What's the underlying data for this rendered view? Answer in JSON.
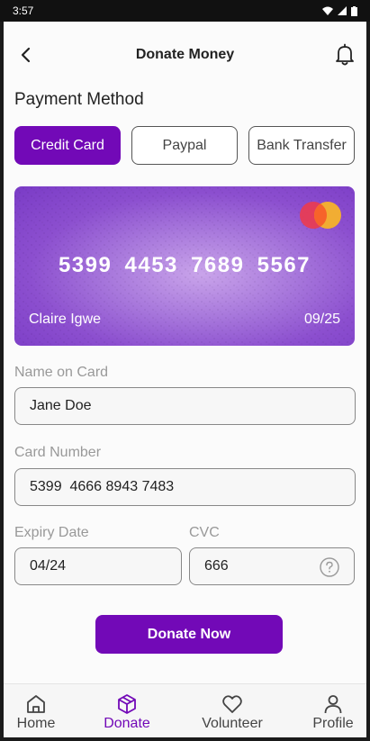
{
  "status_bar": {
    "time": "3:57"
  },
  "header": {
    "title": "Donate Money"
  },
  "payment": {
    "section_title": "Payment Method",
    "tabs": [
      {
        "label": "Credit Card",
        "active": true
      },
      {
        "label": "Paypal",
        "active": false
      },
      {
        "label": "Bank Transfer",
        "active": false
      }
    ]
  },
  "card": {
    "number": "5399 4453 7689 5567",
    "holder": "Claire Igwe",
    "expiry": "09/25",
    "brand_icon": "mastercard-icon"
  },
  "form": {
    "name_label": "Name on Card",
    "name_value": "Jane Doe",
    "number_label": "Card Number",
    "number_value": "5399  4666 8943 7483",
    "expiry_label": "Expiry Date",
    "expiry_value": "04/24",
    "cvc_label": "CVC",
    "cvc_value": "666"
  },
  "actions": {
    "donate_label": "Donate Now"
  },
  "nav": {
    "items": [
      {
        "label": "Home",
        "icon": "home-icon"
      },
      {
        "label": "Donate",
        "icon": "donate-box-icon",
        "active": true
      },
      {
        "label": "Volunteer",
        "icon": "heart-icon"
      },
      {
        "label": "Profile",
        "icon": "person-icon"
      }
    ]
  },
  "colors": {
    "accent": "#7209b7",
    "card_gradient": "#8c4fcf"
  }
}
